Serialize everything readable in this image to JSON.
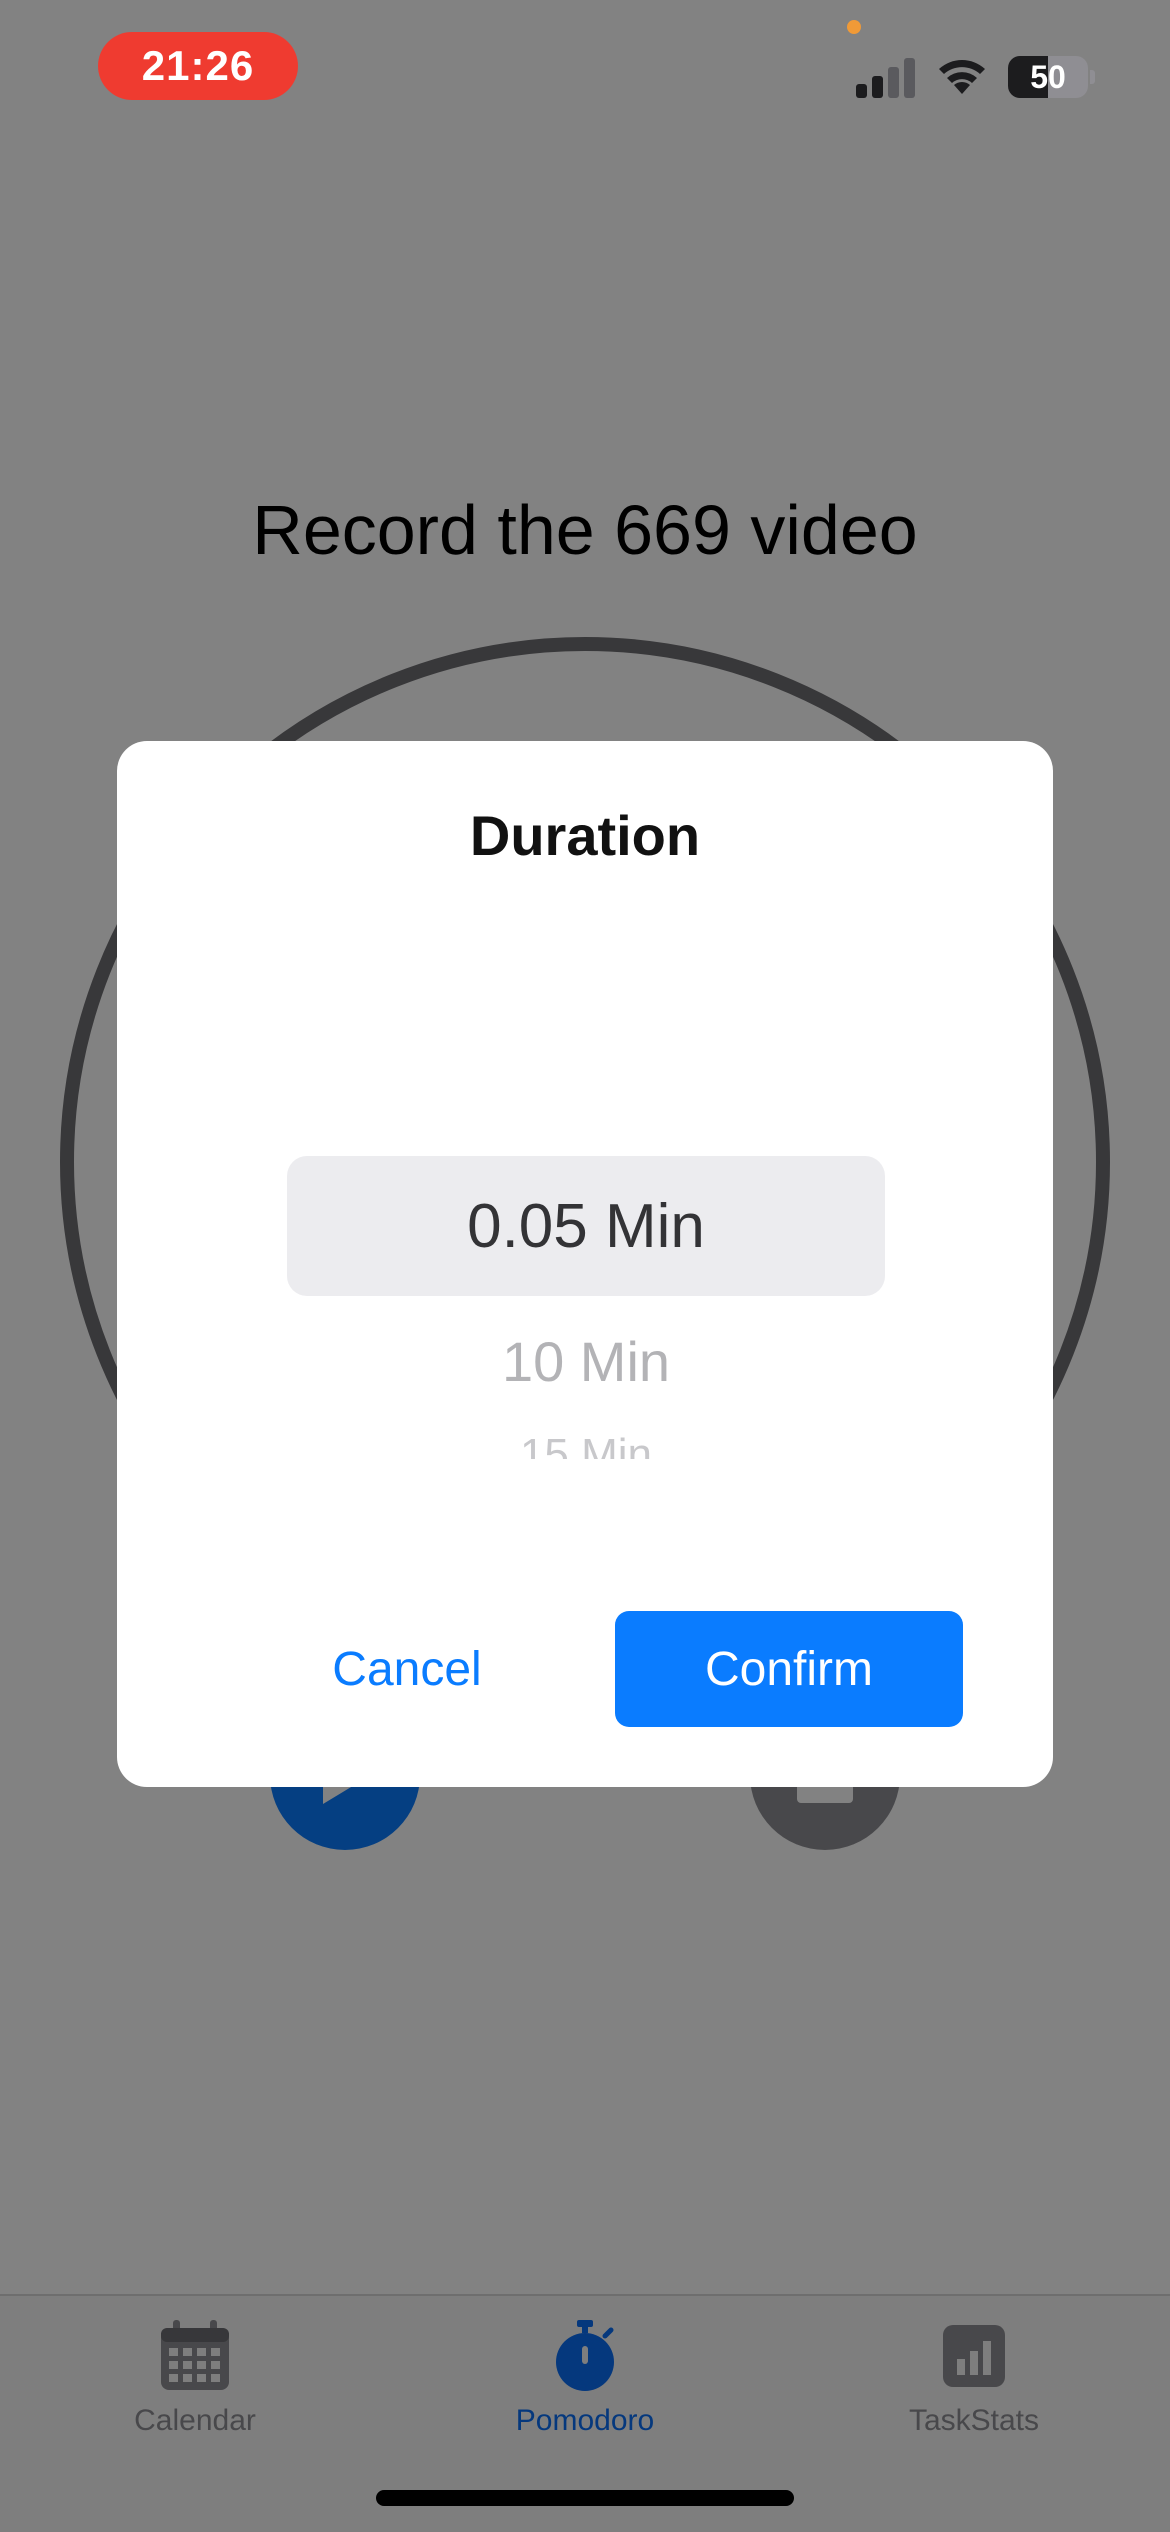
{
  "status_bar": {
    "time": "21:26",
    "battery_percent": "50",
    "battery_level": 0.5
  },
  "page": {
    "task_title": "Record the 669 video"
  },
  "dialog": {
    "title": "Duration",
    "picker_options": [
      "0.05 Min",
      "10 Min",
      "15 Min"
    ],
    "selected_value": "0.05 Min",
    "cancel_label": "Cancel",
    "confirm_label": "Confirm"
  },
  "tab_bar": {
    "tabs": [
      {
        "label": "Calendar",
        "icon": "calendar-icon",
        "active": false
      },
      {
        "label": "Pomodoro",
        "icon": "stopwatch-icon",
        "active": true
      },
      {
        "label": "TaskStats",
        "icon": "chart-icon",
        "active": false
      }
    ]
  },
  "colors": {
    "accent": "#0a7cff",
    "recording_pill": "#ef3b30"
  }
}
